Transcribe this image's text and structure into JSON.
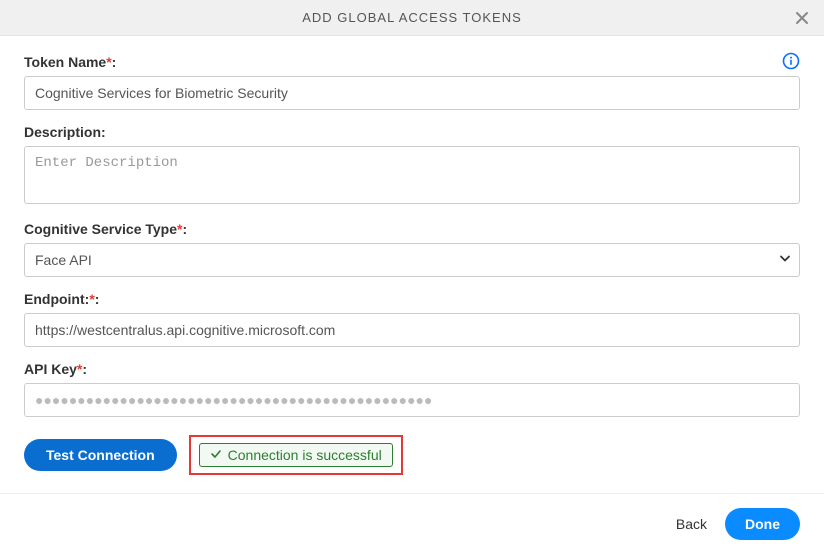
{
  "header": {
    "title": "ADD GLOBAL ACCESS TOKENS"
  },
  "fields": {
    "tokenName": {
      "label": "Token Name",
      "required": "*",
      "colon": ":",
      "value": "Cognitive Services for Biometric Security"
    },
    "description": {
      "label": "Description:",
      "placeholder": "Enter Description",
      "value": ""
    },
    "serviceType": {
      "label": "Cognitive Service Type",
      "required": "*",
      "colon": ":",
      "selected": "Face API"
    },
    "endpoint": {
      "label": "Endpoint:",
      "required": "*",
      "colon": ":",
      "value": "https://westcentralus.api.cognitive.microsoft.com"
    },
    "apiKey": {
      "label": "API Key",
      "required": "*",
      "colon": ":",
      "value": "●●●●●●●●●●●●●●●●●●●●●●●●●●●●●●●●●●●●●●●●●●●●●●●"
    }
  },
  "actions": {
    "testConnection": "Test Connection",
    "statusMessage": "Connection is successful"
  },
  "footer": {
    "back": "Back",
    "done": "Done"
  }
}
